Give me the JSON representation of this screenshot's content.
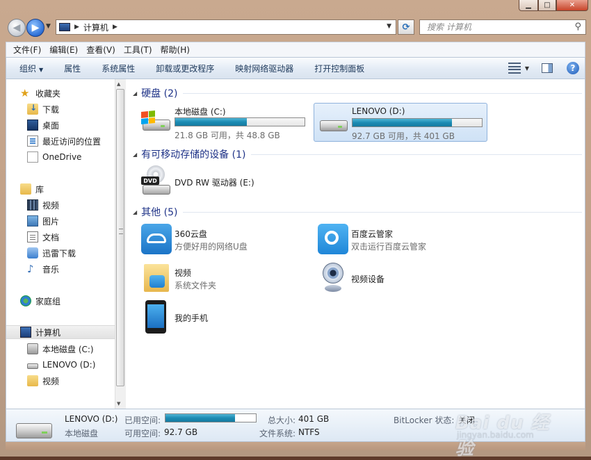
{
  "address": {
    "path": "计算机"
  },
  "search": {
    "placeholder": "搜索 计算机"
  },
  "menu": [
    "文件(F)",
    "编辑(E)",
    "查看(V)",
    "工具(T)",
    "帮助(H)"
  ],
  "toolbar": {
    "organize": "组织",
    "properties": "属性",
    "system_properties": "系统属性",
    "uninstall": "卸载或更改程序",
    "map_drive": "映射网络驱动器",
    "control_panel": "打开控制面板"
  },
  "sidebar": {
    "favorites": "收藏夹",
    "downloads": "下载",
    "desktop": "桌面",
    "recent": "最近访问的位置",
    "onedrive": "OneDrive",
    "libraries": "库",
    "videos": "视频",
    "pictures": "图片",
    "documents": "文档",
    "thunder": "迅雷下载",
    "music": "音乐",
    "homegroup": "家庭组",
    "computer": "计算机",
    "drive_c": "本地磁盘 (C:)",
    "drive_d": "LENOVO (D:)",
    "video_folder": "视频"
  },
  "groups": {
    "hdd": "硬盘 (2)",
    "removable": "有可移动存储的设备 (1)",
    "other": "其他 (5)"
  },
  "drives": [
    {
      "name": "本地磁盘 (C:)",
      "free_text": "21.8 GB 可用，共 48.8 GB",
      "used_fraction": 0.553
    },
    {
      "name": "LENOVO (D:)",
      "free_text": "92.7 GB 可用，共 401 GB",
      "used_fraction": 0.769
    }
  ],
  "dvd": {
    "name": "DVD RW 驱动器 (E:)",
    "badge": "DVD"
  },
  "others": [
    {
      "name": "360云盘",
      "sub": "方便好用的网络U盘"
    },
    {
      "name": "百度云管家",
      "sub": "双击运行百度云管家"
    },
    {
      "name": "视频",
      "sub": "系统文件夹"
    },
    {
      "name": "视频设备"
    },
    {
      "name": "我的手机"
    }
  ],
  "details": {
    "name": "LENOVO (D:)",
    "type": "本地磁盘",
    "used_label": "已用空间:",
    "free_label": "可用空间:",
    "free_value": "92.7 GB",
    "total_label": "总大小:",
    "total_value": "401 GB",
    "fs_label": "文件系统:",
    "fs_value": "NTFS",
    "bitlocker_label": "BitLocker 状态:",
    "bitlocker_value": "关闭",
    "used_fraction": 0.769
  },
  "watermark": {
    "line1": "Bai du 经验",
    "line2": "jingyan.baidu.com"
  }
}
